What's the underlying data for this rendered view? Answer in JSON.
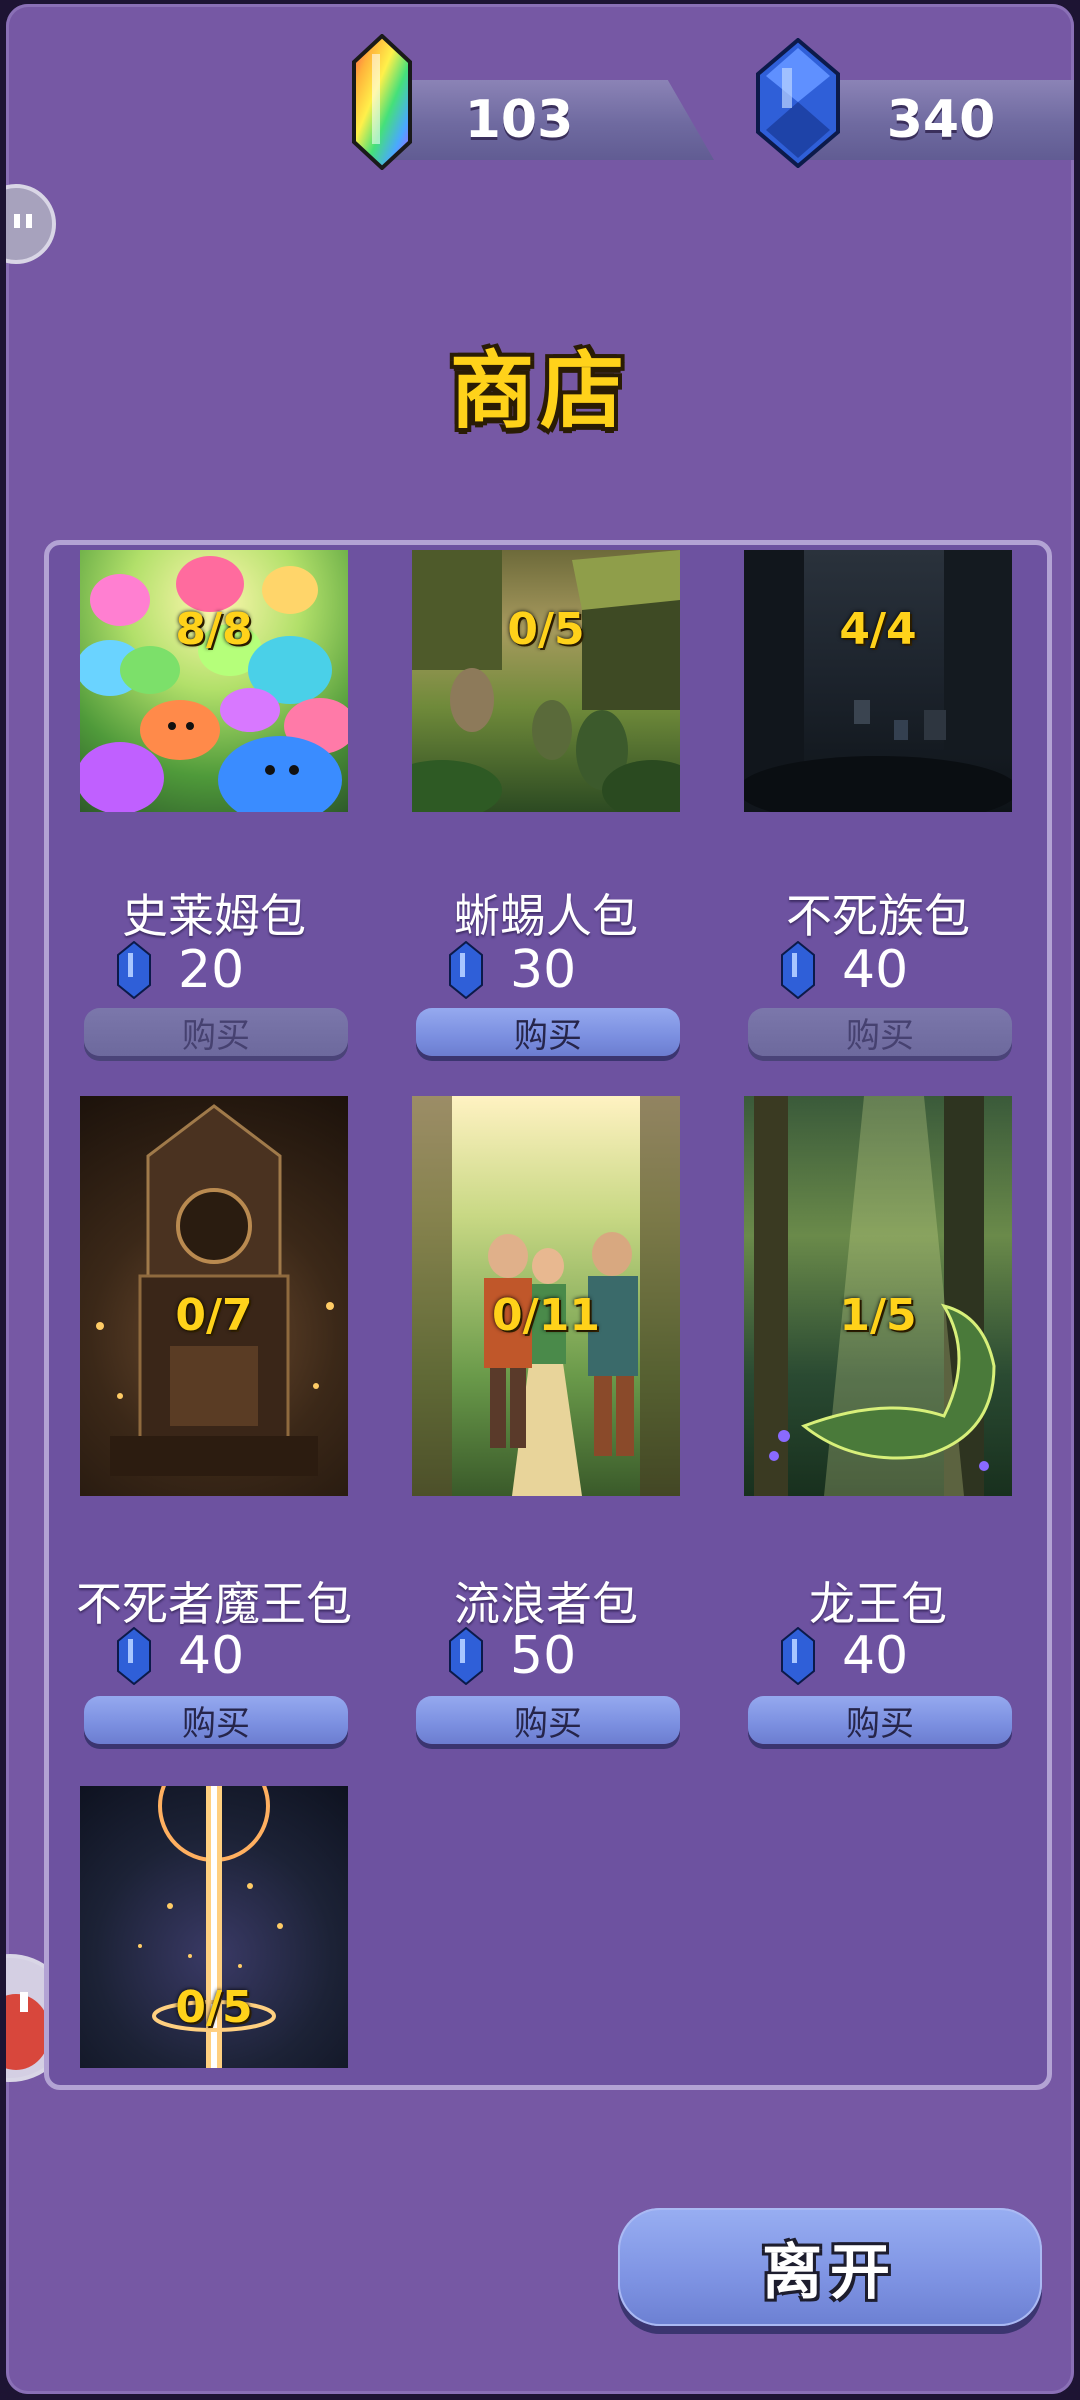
{
  "currencies": {
    "rainbow": {
      "value": "103",
      "icon": "rainbow-crystal-icon"
    },
    "blue": {
      "value": "340",
      "icon": "blue-gem-icon"
    }
  },
  "shop": {
    "title": "商店",
    "buy_label": "购买",
    "leave_label": "离开",
    "packs": [
      {
        "name": "史莱姆包",
        "price": "20",
        "count": "8/8",
        "buy_enabled": false,
        "art": "slimes"
      },
      {
        "name": "蜥蜴人包",
        "price": "30",
        "count": "0/5",
        "buy_enabled": true,
        "art": "lizardfolk"
      },
      {
        "name": "不死族包",
        "price": "40",
        "count": "4/4",
        "buy_enabled": false,
        "art": "graveyard"
      },
      {
        "name": "不死者魔王包",
        "price": "40",
        "count": "0/7",
        "buy_enabled": true,
        "art": "throne"
      },
      {
        "name": "流浪者包",
        "price": "50",
        "count": "0/11",
        "buy_enabled": true,
        "art": "wanderers"
      },
      {
        "name": "龙王包",
        "price": "40",
        "count": "1/5",
        "buy_enabled": true,
        "art": "forest-dragon"
      },
      {
        "name": "",
        "price": "",
        "count": "0/5",
        "buy_enabled": false,
        "art": "light-pillar"
      }
    ]
  },
  "colors": {
    "background": "#7658a4",
    "title": "#ffd21a",
    "button": "#7b8fe0",
    "count": "#ffd21a"
  }
}
